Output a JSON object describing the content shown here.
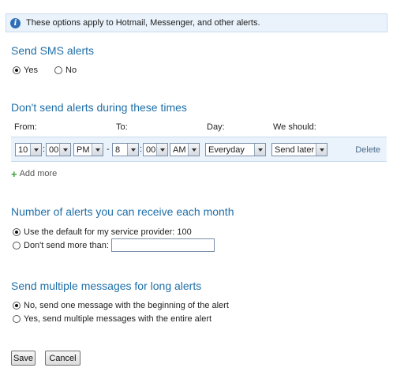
{
  "info": {
    "icon": "info-icon",
    "text": "These options apply to Hotmail, Messenger, and other alerts."
  },
  "sms": {
    "heading": "Send SMS alerts",
    "options": [
      {
        "label": "Yes",
        "selected": true
      },
      {
        "label": "No",
        "selected": false
      }
    ]
  },
  "quiet": {
    "heading": "Don't send alerts during these times",
    "columns": {
      "from": "From:",
      "to": "To:",
      "day": "Day:",
      "action": "We should:"
    },
    "row": {
      "from_hour": "10",
      "from_sep": ":",
      "from_minute": "00",
      "from_ampm": "PM",
      "dash": "-",
      "to_hour": "8",
      "to_sep": ":",
      "to_minute": "00",
      "to_ampm": "AM",
      "day": "Everyday",
      "action": "Send later",
      "delete": "Delete"
    },
    "add_more": "Add more"
  },
  "monthly": {
    "heading": "Number of alerts you can receive each month",
    "options": [
      {
        "label": "Use the default for my service provider: 100",
        "selected": true
      },
      {
        "label": "Don't send more than:",
        "selected": false
      }
    ],
    "limit_value": ""
  },
  "long": {
    "heading": "Send multiple messages for long alerts",
    "options": [
      {
        "label": "No, send one message with the beginning of the alert",
        "selected": true
      },
      {
        "label": "Yes, send multiple messages with the entire alert",
        "selected": false
      }
    ]
  },
  "buttons": {
    "save": "Save",
    "cancel": "Cancel"
  }
}
